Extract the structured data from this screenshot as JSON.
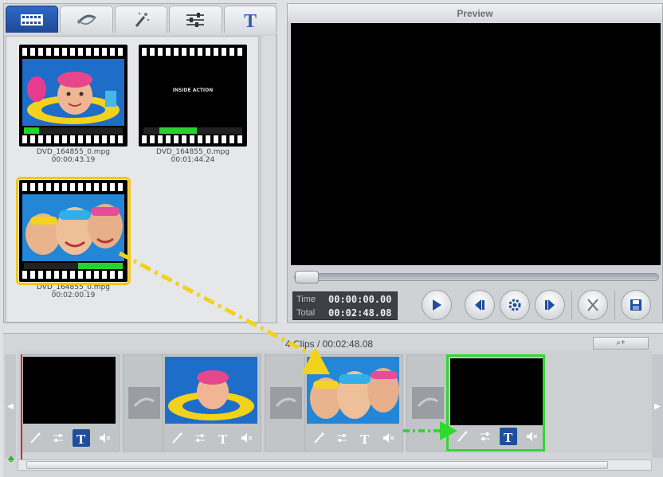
{
  "media_tabs": [
    "media-tab",
    "transition-tab",
    "effects-tab",
    "adjust-tab",
    "text-tab"
  ],
  "library": {
    "clips": [
      {
        "name": "DVD_164855_0.mpg",
        "duration": "00:00:43.19",
        "progress": 0.15
      },
      {
        "name": "DVD_164855_0.mpg",
        "duration": "00:01:44.24",
        "progress": 0.38
      },
      {
        "name": "DVD_164855_0.mpg",
        "duration": "00:02:00.19",
        "progress": 0.45
      }
    ],
    "black_clip_text": "INSIDE ACTION"
  },
  "preview": {
    "title": "Preview",
    "time_label": "Time",
    "total_label": "Total",
    "time_value": "00:00:00.00",
    "total_value": "00:02:48.08"
  },
  "timeline": {
    "info": "4 Clips / 00:02:48.08",
    "zoom_text": "⌕+",
    "tools": [
      "effects-tool",
      "adjust-tool",
      "text-tool",
      "mute-tool"
    ]
  },
  "colors": {
    "accent": "#1f4e9c",
    "selected_clip": "#2fd92f",
    "library_selected": "#f6c517",
    "arrow": "#f2d21a"
  }
}
